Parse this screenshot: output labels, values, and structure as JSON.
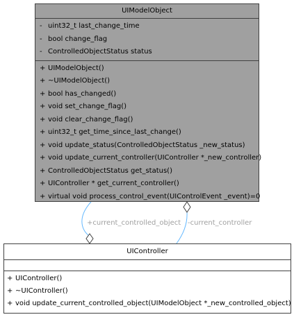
{
  "model_object": {
    "name": "UIModelObject",
    "attributes": [
      {
        "vis": "-",
        "text": "uint32_t last_change_time"
      },
      {
        "vis": "-",
        "text": "bool change_flag"
      },
      {
        "vis": "-",
        "text": "ControlledObjectStatus status"
      }
    ],
    "operations": [
      {
        "vis": "+",
        "text": "UIModelObject()"
      },
      {
        "vis": "+",
        "text": "~UIModelObject()"
      },
      {
        "vis": "+",
        "text": "bool has_changed()"
      },
      {
        "vis": "+",
        "text": "void set_change_flag()"
      },
      {
        "vis": "+",
        "text": "void clear_change_flag()"
      },
      {
        "vis": "+",
        "text": "uint32_t get_time_since_last_change()"
      },
      {
        "vis": "+",
        "text": "void update_status(ControlledObjectStatus _new_status)"
      },
      {
        "vis": "+",
        "text": "void update_current_controller(UIController *_new_controller)"
      },
      {
        "vis": "+",
        "text": "ControlledObjectStatus get_status()"
      },
      {
        "vis": "+",
        "text": "UIController * get_current_controller()"
      },
      {
        "vis": "+",
        "text": "virtual void process_control_event(UIControlEvent _event)=0"
      }
    ]
  },
  "controller": {
    "name": "UIController",
    "operations": [
      {
        "vis": "+",
        "text": "UIController()"
      },
      {
        "vis": "+",
        "text": "~UIController()"
      },
      {
        "vis": "+",
        "text": "void update_current_controlled_object(UIModelObject *_new_controlled_object)"
      }
    ]
  },
  "associations": {
    "controlled_object_label": "+current_controlled_object",
    "controller_label": "-current_controller"
  },
  "colors": {
    "highlighted_class_fill": "#a0a0a0",
    "class_fill": "#ffffff",
    "border": "#404040",
    "edge": "#63b8ff",
    "edge_label": "#a0a0a0"
  }
}
